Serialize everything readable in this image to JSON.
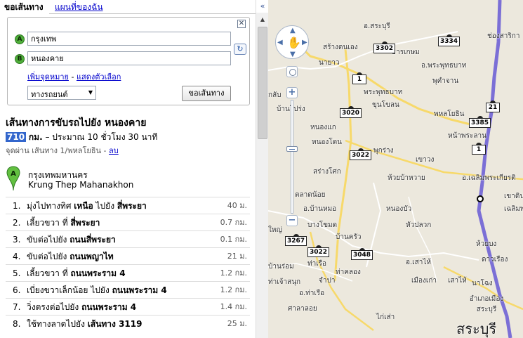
{
  "tabs": {
    "directions": "ขอเส้นทาง",
    "mymaps": "แผนที่ของฉัน"
  },
  "directions_box": {
    "close_icon": "close-icon",
    "waypoint_a": {
      "marker": "A",
      "value": "กรุงเทพ"
    },
    "waypoint_b": {
      "marker": "B",
      "value": "หนองคาย"
    },
    "add_destination": "เพิ่มจุดหมาย",
    "separator": "-",
    "show_options": "แสดงตัวเลือก",
    "mode": "ทางรถยนต์",
    "go_button": "ขอเส้นทาง"
  },
  "route": {
    "title": "เส้นทางการขับรถไปยัง หนองคาย",
    "distance": "710",
    "distance_unit": "กม.",
    "duration_text": "– ประมาณ 10 ชั่วโมง 30 นาที",
    "via_text": "จุดผ่าน เส้นทาง 1/พหลโยธิน -",
    "via_remove": "ลบ",
    "start_marker": "A",
    "start_name_th": "กรุงเทพมหานคร",
    "start_name_en": "Krung Thep Mahanakhon",
    "steps": [
      {
        "num": "1.",
        "pre": "มุ่งไปทางทิศ ",
        "b1": "เหนือ",
        "mid": " ไปยัง ",
        "b2": "สี่พระยา",
        "dist": "40 ม."
      },
      {
        "num": "2.",
        "pre": "เลี้ยวขวา ที่ ",
        "b1": "สี่พระยา",
        "mid": "",
        "b2": "",
        "dist": "0.7 กม."
      },
      {
        "num": "3.",
        "pre": "ขับต่อไปยัง ",
        "b1": "ถนนสี่พระยา",
        "mid": "",
        "b2": "",
        "dist": "0.1 กม."
      },
      {
        "num": "4.",
        "pre": "ขับต่อไปยัง ",
        "b1": "ถนนพญาไท",
        "mid": "",
        "b2": "",
        "dist": "21 ม."
      },
      {
        "num": "5.",
        "pre": "เลี้ยวขวา ที่ ",
        "b1": "ถนนพระราม 4",
        "mid": "",
        "b2": "",
        "dist": "1.2 กม."
      },
      {
        "num": "6.",
        "pre": "เบี่ยงขวาเล็กน้อย ไปยัง ",
        "b1": "ถนนพระราม 4",
        "mid": "",
        "b2": "",
        "dist": "1.2 กม."
      },
      {
        "num": "7.",
        "pre": "วิ่งตรงต่อไปยัง ",
        "b1": "ถนนพระราม 4",
        "mid": "",
        "b2": "",
        "dist": "1.4 กม."
      },
      {
        "num": "8.",
        "pre": "ใช้ทางลาดไปยัง ",
        "b1": "เส้นทาง 3119",
        "mid": "",
        "b2": "",
        "dist": "25 ม."
      }
    ]
  },
  "scroll": {
    "collapse": "«",
    "up": "▲"
  },
  "map": {
    "colors": {
      "background": "#ece8dd",
      "route": "#7b6fd6",
      "highway": "#f7d96a",
      "road": "#ffffff"
    },
    "labels": [
      "อ.สระบุรี",
      "สร้างดนเอง",
      "นายาว",
      "ธารเกษม",
      "อ.พระพุทธบาท",
      "พุคำจาน",
      "ช่องสาริกา",
      "พระพุทธบาท",
      "ขุนโขลน",
      "พหลโยธิน",
      "หน้าพระลาน",
      "กลับ",
      "บ้านโปร่ง",
      "หนองแก",
      "หนองโดน",
      "พุกร่าง",
      "เขาวง",
      "อ.เฉลิมพระเกียรติ",
      "สร่างโศก",
      "ห้วยบ้าหวาย",
      "เขาดิน",
      "ตลาดน้อย",
      "อ.บ้านหมอ",
      "หนองบัว",
      "เฉลิมพระเกียรติ",
      "บางโขมด",
      "บ้านครัว",
      "หัวปลวก",
      "ใหญ่",
      "บ้านร่อม",
      "ท่าเรือ",
      "อ.เสาไห้",
      "ห้วยบง",
      "ดาวเรือง",
      "ท่าเจ้าสนุก",
      "จำปา",
      "ท่าคลอง",
      "เมืองเก่า",
      "เสาไห้",
      "นาโฉง",
      "อ.ท่าเรือ",
      "ศาลาลอย",
      "ไก่เส่า",
      "อำเภอเมือง สระบุรี",
      "สระบุรี"
    ],
    "shields": [
      "3302",
      "3334",
      "1",
      "3020",
      "3385",
      "21",
      "3022",
      "1",
      "3267",
      "3022",
      "3048"
    ]
  }
}
